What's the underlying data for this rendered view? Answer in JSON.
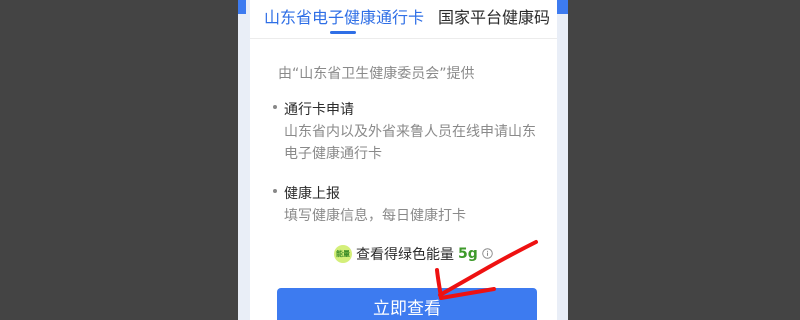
{
  "tabs": {
    "active": "山东省电子健康通行卡",
    "inactive": "国家平台健康码"
  },
  "provider": "由“山东省卫生健康委员会”提供",
  "items": [
    {
      "title": "通行卡申请",
      "description": "山东省内以及外省来鲁人员在线申请山东电子健康通行卡"
    },
    {
      "title": "健康上报",
      "description": "填写健康信息，每日健康打卡"
    }
  ],
  "energy": {
    "badge": "能量",
    "text": "查看得绿色能量",
    "amount": "5g"
  },
  "button": {
    "label": "立即查看"
  },
  "colors": {
    "accent": "#3d7bf0",
    "green": "#3e9a2b",
    "annotation": "#ee1111"
  }
}
